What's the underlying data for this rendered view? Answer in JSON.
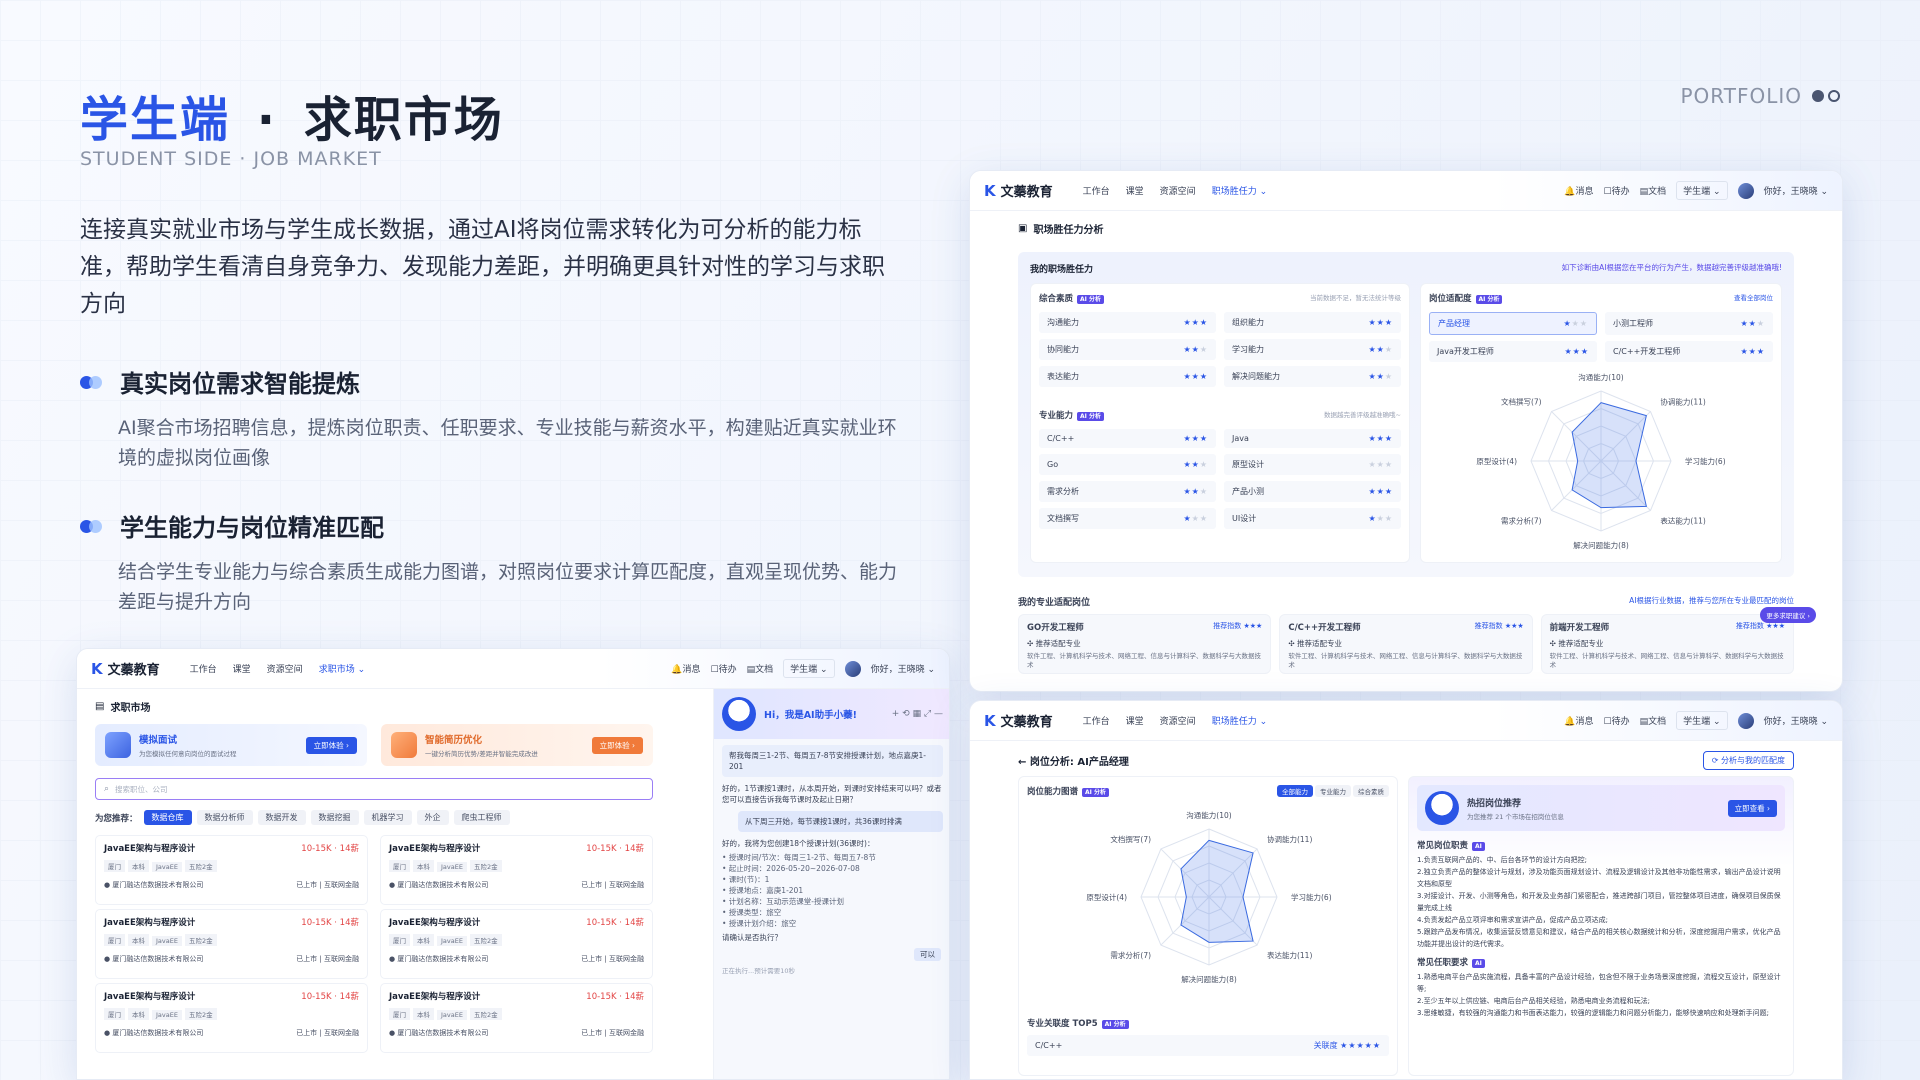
{
  "header": {
    "title_part1": "学生端",
    "title_sep": "·",
    "title_part2": "求职市场",
    "subtitle": "STUDENT SIDE · JOB MARKET",
    "portfolio": "PORTFOLIO"
  },
  "intro": "连接真实就业市场与学生成长数据，通过AI将岗位需求转化为可分析的能力标准，帮助学生看清自身竞争力、发现能力差距，并明确更具针对性的学习与求职方向",
  "features": [
    {
      "title": "真实岗位需求智能提炼",
      "desc": "AI聚合市场招聘信息，提炼岗位职责、任职要求、专业技能与薪资水平，构建贴近真实就业环境的虚拟岗位画像"
    },
    {
      "title": "学生能力与岗位精准匹配",
      "desc": "结合学生专业能力与综合素质生成能力图谱，对照岗位要求计算匹配度，直观呈现优势、能力差距与提升方向"
    }
  ],
  "app": {
    "brand": "文蓁教育",
    "nav_links": [
      "工作台",
      "课堂",
      "资源空间"
    ],
    "nav_active_market": "求职市场",
    "nav_active_comp": "职场胜任力",
    "msg": "消息",
    "todo": "待办",
    "doc": "文档",
    "role": "学生端",
    "greet": "你好，王晓晓"
  },
  "market": {
    "page_title": "求职市场",
    "promo1_title": "模拟面试",
    "promo1_desc": "为您模拟任何意向岗位的面试过程",
    "promo1_btn": "立即体验",
    "promo2_title": "智能简历优化",
    "promo2_desc": "一键分析简历优势/差距并智能完成改进",
    "promo2_btn": "立即体验",
    "search_placeholder": "搜索职位、公司",
    "rec_label": "为您推荐：",
    "chips": [
      "数据仓库",
      "数据分析师",
      "数据开发",
      "数据挖掘",
      "机器学习",
      "外企",
      "爬虫工程师"
    ],
    "job_title": "JavaEE架构与程序设计",
    "job_salary": "10-15K · 14薪",
    "job_tags": [
      "厦门",
      "本科",
      "JavaEE",
      "五险2金"
    ],
    "job_company": "厦门融达信数据技术有限公司",
    "job_status": "已上市 | 互联网金融"
  },
  "chat": {
    "greeting": "Hi，我是AI助手小蓁!",
    "q1": "帮我每周三1-2节、每周五7-8节安排授课计划，地点嘉庚1-201",
    "a1": "好的，1节课按1课时，从本周开始，到课时安排结束可以吗？或者您可以直接告诉我每节课时及起止日期？",
    "q2": "从下周三开始，每节课按1课时，共36课时排满",
    "a2": "好的，我将为您创建18个授课计划(36课时)：",
    "list": [
      "授课时间/节次：每周三1-2节、每周五7-8节",
      "起止时间：2026-05-20~2026-07-08",
      "课时(节)：1",
      "授课地点：嘉庚1-201",
      "计划名称：互动示范课堂-授课计划",
      "授课类型：旅空",
      "授课计划介绍：旅空"
    ],
    "confirm": "请确认是否执行？",
    "yes": "可以",
    "status": "正在执行...预计需要10秒"
  },
  "comp": {
    "page_title": "职场胜任力分析",
    "panel_title": "我的职场胜任力",
    "panel_hint": "如下诊断由AI根据您在平台的行为产生，数据越完善评级越准确哦!",
    "soft_title": "综合素质",
    "soft_hint": "当前数据不足，暂无法统计等级",
    "soft_items": [
      {
        "n": "沟通能力",
        "s": 3
      },
      {
        "n": "组织能力",
        "s": 3
      },
      {
        "n": "协同能力",
        "s": 2
      },
      {
        "n": "学习能力",
        "s": 2
      },
      {
        "n": "表达能力",
        "s": 3
      },
      {
        "n": "解决问题能力",
        "s": 2
      }
    ],
    "pro_title": "专业能力",
    "pro_hint": "数据越完善评级越准确哦~",
    "pro_items": [
      {
        "n": "C/C++",
        "s": 3
      },
      {
        "n": "Java",
        "s": 3
      },
      {
        "n": "Go",
        "s": 2
      },
      {
        "n": "原型设计",
        "s": 0
      },
      {
        "n": "需求分析",
        "s": 2
      },
      {
        "n": "产品小测",
        "s": 3
      },
      {
        "n": "文档撰写",
        "s": 1
      },
      {
        "n": "UI设计",
        "s": 1
      }
    ],
    "fit_title": "岗位适配度",
    "fit_link": "查看全部岗位",
    "fit_items": [
      {
        "n": "产品经理",
        "s": 1
      },
      {
        "n": "小测工程师",
        "s": 2
      },
      {
        "n": "Java开发工程师",
        "s": 3
      },
      {
        "n": "C/C++开发工程师",
        "s": 3
      }
    ],
    "radar_labels": [
      "沟通能力(10)",
      "协调能力(11)",
      "学习能力(6)",
      "表达能力(11)",
      "解决问题能力(8)",
      "需求分析(7)",
      "原型设计(4)",
      "文档撰写(7)"
    ],
    "radar_values": [
      10,
      11,
      6,
      11,
      8,
      7,
      4,
      7
    ],
    "match_title": "我的专业适配岗位",
    "match_hint": "AI根据行业数据，推荐与您所在专业最匹配的岗位",
    "match_jobs": [
      "GO开发工程师",
      "C/C++开发工程师",
      "前端开发工程师"
    ],
    "rec_index": "推荐指数",
    "rec_major": "推荐适配专业",
    "majors": "软件工程、计算机科学与技术、网络工程、信息与计算科学、数据科学与大数据技术",
    "more_btn": "更多求职建议"
  },
  "analysis": {
    "page_title": "岗位分析: AI产品经理",
    "compare_btn": "分析与我的匹配度",
    "chart_title": "岗位能力图谱",
    "tabs": [
      "全部能力",
      "专业能力",
      "综合素质"
    ],
    "radar_labels": [
      "沟通能力(10)",
      "协调能力(11)",
      "学习能力(6)",
      "表达能力(11)",
      "解决问题能力(8)",
      "需求分析(7)",
      "原型设计(4)",
      "文档撰写(7)"
    ],
    "radar_values": [
      10,
      11,
      6,
      11,
      8,
      7,
      4,
      7
    ],
    "hot_title": "热招岗位推荐",
    "hot_desc": "为您推荐 21 个市场在招岗位信息",
    "hot_btn": "立即查看",
    "duty_title": "常见岗位职责",
    "duties": [
      "1.负责互联网产品的、中、后台各环节的设计方向把控;",
      "2.独立负责产品的整体设计与规划，涉及功能页面规划设计、流程及逻辑设计及其他非功能性需求，输出产品设计说明文档和原型",
      "3.对接设计、开发、小测等角色，和开发及业务部门紧密配合，推进跨部门项目，管控整体项目进度，确保项目保质保量完成上线",
      "4.负责发起产品立项评审和需求宣讲产品，促成产品立项达成;",
      "5.跟踪产品发布情况，收集运营反馈意见和建议，结合产品的相关核心数据统计和分析，深度挖掘用户需求，优化产品功能并提出设计的迭代需求。"
    ],
    "req_title": "常见任职要求",
    "reqs": [
      "1.熟悉电商平台产品实施流程，具备丰富的产品设计经验，包含但不限于业务场景深度挖掘，流程交互设计，原型设计等;",
      "2.至少五年以上供应链、电商后台产品相关经验，熟悉电商业务流程和玩法;",
      "3.思维敏捷，有较强的沟通能力和书面表达能力，较强的逻辑能力和问题分析能力，能够快速响应和处理新手问题;"
    ],
    "top_title": "专业关联度 TOP5",
    "top_item": "C/C++",
    "top_label": "关联度"
  }
}
